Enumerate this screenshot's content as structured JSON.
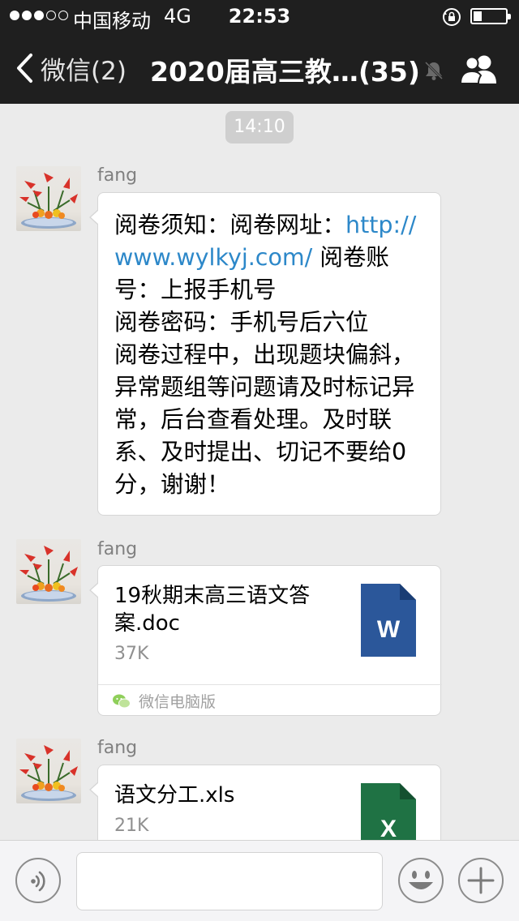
{
  "status_bar": {
    "carrier": "中国移动",
    "network": "4G",
    "time": "22:53",
    "signal_bars_filled": 3,
    "signal_bars_total": 5,
    "battery_level": 0.2
  },
  "nav": {
    "back_label": "微信(2)",
    "title": "2020届高三教…(35)",
    "icons": [
      "chevron-left-icon",
      "mute-bell-icon",
      "group-members-icon"
    ]
  },
  "chat": {
    "timestamp": "14:10",
    "messages": [
      {
        "sender": "fang",
        "type": "text",
        "text_before_link": "阅卷须知：阅卷网址：",
        "link": "http://www.wylkyj.com/",
        "text_after_link": " 阅卷账号：上报手机号\n阅卷密码：手机号后六位\n阅卷过程中，出现题块偏斜，异常题组等问题请及时标记异常，后台查看处理。及时联系、及时提出、切记不要给0分，谢谢！"
      },
      {
        "sender": "fang",
        "type": "file",
        "file_name": "19秋期末高三语文答案.doc",
        "file_size": "37K",
        "file_icon": "word-doc-icon",
        "file_icon_letter": "W",
        "file_icon_color": "#2b579a",
        "source": "微信电脑版"
      },
      {
        "sender": "fang",
        "type": "file",
        "file_name": "语文分工.xls",
        "file_size": "21K",
        "file_icon": "excel-xls-icon",
        "file_icon_letter": "X",
        "file_icon_color": "#1f7244"
      }
    ]
  },
  "input_bar": {
    "placeholder": "",
    "icons": [
      "voice-icon",
      "emoji-icon",
      "plus-icon"
    ]
  }
}
